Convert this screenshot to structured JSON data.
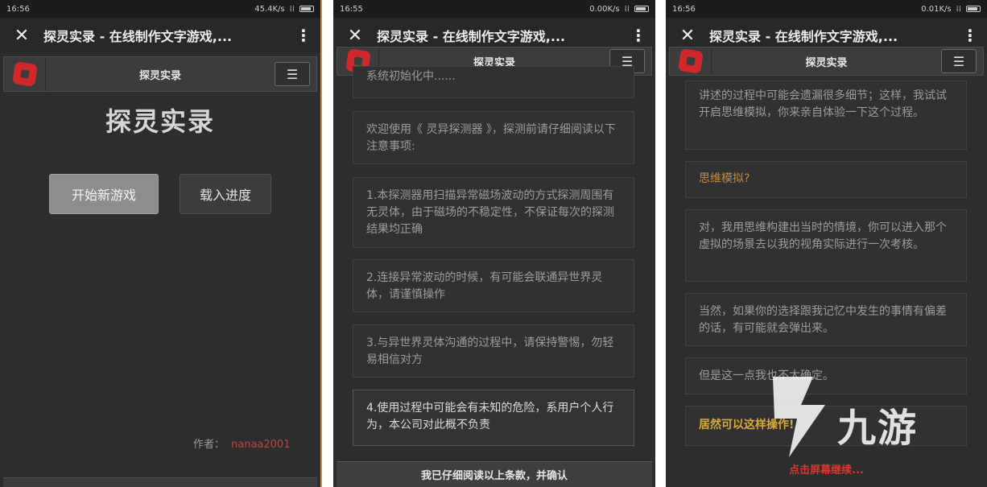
{
  "screens": [
    {
      "status": {
        "time": "16:56",
        "speed": "45.4K/s"
      },
      "appbar": {
        "title": "探灵实录 - 在线制作文字游戏,..."
      },
      "gamebar": {
        "title": "探灵实录"
      },
      "main": {
        "title": "探灵实录",
        "start_label": "开始新游戏",
        "load_label": "载入进度",
        "author_label": "作者：",
        "author_name": "nanaa2001"
      }
    },
    {
      "status": {
        "time": "16:55",
        "speed": "0.00K/s"
      },
      "appbar": {
        "title": "探灵实录 - 在线制作文字游戏,..."
      },
      "gamebar": {
        "title": "探灵实录"
      },
      "messages": [
        "系统初始化中......",
        "欢迎使用《 灵异探测器 》，探测前请仔细阅读以下注意事项:",
        "1.本探测器用扫描异常磁场波动的方式探测周围有无灵体，由于磁场的不稳定性，不保证每次的探测结果均正确",
        "2.连接异常波动的时候，有可能会联通异世界灵体，请谨慎操作",
        "3.与异世界灵体沟通的过程中，请保持警惕，勿轻易相信对方",
        "4.使用过程中可能会有未知的危险，系用户个人行为，本公司对此概不负责"
      ],
      "confirm_label": "我已仔细阅读以上条款，并确认"
    },
    {
      "status": {
        "time": "16:56",
        "speed": "0.01K/s"
      },
      "appbar": {
        "title": "探灵实录 - 在线制作文字游戏,..."
      },
      "gamebar": {
        "title": "探灵实录"
      },
      "messages": [
        "讲述的过程中可能会遗漏很多细节；这样，我试试开启思维模拟，你来亲自体验一下这个过程。",
        "思维模拟?",
        "对，我用思维构建出当时的情境，你可以进入那个虚拟的场景去以我的视角实际进行一次考核。",
        "当然，如果你的选择跟我记忆中发生的事情有偏差的话，有可能就会弹出来。",
        "但是这一点我也不太确定。",
        "居然可以这样操作!"
      ],
      "continue_label": "点击屏幕继续..."
    }
  ],
  "watermark": {
    "text": "九游"
  },
  "colors": {
    "accent_orange": "#e58a2a",
    "author_red": "#c0463c",
    "continue_red": "#d63a2a"
  }
}
